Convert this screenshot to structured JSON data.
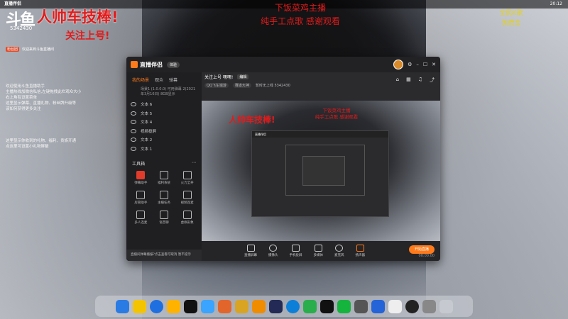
{
  "menubar": {
    "app_name": "直播伴侣",
    "time": "20:12"
  },
  "overlay": {
    "douyu_logo": "斗鱼",
    "headline": "人帅车技棒!",
    "room_id": "5342430",
    "follow": "关注上号!",
    "center_lines": [
      "下饭菜鸡主播",
      "纯手工点歌 感谢观看"
    ],
    "right_lines": [
      "全民K歌",
      "免费会"
    ],
    "notes_1": [
      "欢迎使用斗鱼直播助手",
      "主播热线加微信私信,左键拖拽此栏观众大小",
      "右上角有设置菜单",
      "这里显示弹幕、直播礼物、粉丝牌升级等",
      "该如何获得更多关注"
    ],
    "notes_2": [
      "这里显示你收到的礼物、福利、贵族开通",
      "点这里可设置小礼物屏蔽"
    ],
    "fan_badge": "粉丝团",
    "fan_text": "欢迎来到斗鱼直播间"
  },
  "window": {
    "logo": "直播伴侣",
    "logo_pill": "体验",
    "sidebar": {
      "tabs": [
        "我的场景",
        "观众",
        "弹幕"
      ],
      "scene_info": "场景1 (1.0.0.0) 可用弹幕 2(2021年3月16日) 8GB显示",
      "sources": [
        "文本 6",
        "文本 5",
        "文本 4",
        "视频投屏",
        "文本 2",
        "文本 1"
      ],
      "tools_title": "工具箱",
      "tools": [
        "弹幕助手",
        "福利系统",
        "火力全开",
        "房管助手",
        "主播任务",
        "视频连麦",
        "多人连麦",
        "语音聊",
        "虚拟形象",
        "主播榜",
        "粉丝任务",
        "更多"
      ],
      "notice": "直播间弹幕播报?点击查看可取消 暂不提示"
    },
    "main": {
      "room_title": "关注上号 嘿嘿!",
      "edit_label": "编辑",
      "room_tags": [
        "QQ飞车端游",
        "赛道大神"
      ],
      "room_meta": "暂时无上线  5342430",
      "preview_title": "人帅车技棒!",
      "preview_center": [
        "下饭菜鸡主播",
        "纯手工点歌 感谢观看"
      ],
      "bottom_tools": [
        "直播屏幕",
        "摄像头",
        "手机投屏",
        "多媒体",
        "麦克风",
        "扬声器"
      ],
      "live_button": "开始直播",
      "status_time": "00:00:00"
    }
  },
  "dock": {
    "apps": [
      "desktop",
      "qq-music",
      "app-k",
      "taobao",
      "circle-app",
      "folder",
      "ppt",
      "fox",
      "ink",
      "steam",
      "edge",
      "wechat",
      "qq",
      "iqiyi",
      "genshin",
      "rocket",
      "calendar",
      "clock",
      "settings",
      "trash"
    ]
  }
}
